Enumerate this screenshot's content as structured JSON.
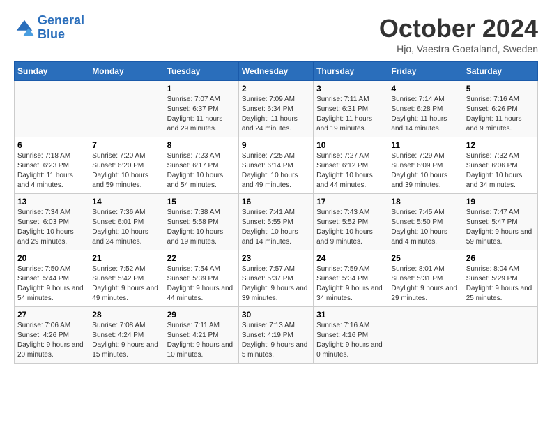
{
  "logo": {
    "line1": "General",
    "line2": "Blue"
  },
  "title": "October 2024",
  "location": "Hjo, Vaestra Goetaland, Sweden",
  "days_of_week": [
    "Sunday",
    "Monday",
    "Tuesday",
    "Wednesday",
    "Thursday",
    "Friday",
    "Saturday"
  ],
  "weeks": [
    [
      {
        "day": "",
        "info": ""
      },
      {
        "day": "",
        "info": ""
      },
      {
        "day": "1",
        "info": "Sunrise: 7:07 AM\nSunset: 6:37 PM\nDaylight: 11 hours and 29 minutes."
      },
      {
        "day": "2",
        "info": "Sunrise: 7:09 AM\nSunset: 6:34 PM\nDaylight: 11 hours and 24 minutes."
      },
      {
        "day": "3",
        "info": "Sunrise: 7:11 AM\nSunset: 6:31 PM\nDaylight: 11 hours and 19 minutes."
      },
      {
        "day": "4",
        "info": "Sunrise: 7:14 AM\nSunset: 6:28 PM\nDaylight: 11 hours and 14 minutes."
      },
      {
        "day": "5",
        "info": "Sunrise: 7:16 AM\nSunset: 6:26 PM\nDaylight: 11 hours and 9 minutes."
      }
    ],
    [
      {
        "day": "6",
        "info": "Sunrise: 7:18 AM\nSunset: 6:23 PM\nDaylight: 11 hours and 4 minutes."
      },
      {
        "day": "7",
        "info": "Sunrise: 7:20 AM\nSunset: 6:20 PM\nDaylight: 10 hours and 59 minutes."
      },
      {
        "day": "8",
        "info": "Sunrise: 7:23 AM\nSunset: 6:17 PM\nDaylight: 10 hours and 54 minutes."
      },
      {
        "day": "9",
        "info": "Sunrise: 7:25 AM\nSunset: 6:14 PM\nDaylight: 10 hours and 49 minutes."
      },
      {
        "day": "10",
        "info": "Sunrise: 7:27 AM\nSunset: 6:12 PM\nDaylight: 10 hours and 44 minutes."
      },
      {
        "day": "11",
        "info": "Sunrise: 7:29 AM\nSunset: 6:09 PM\nDaylight: 10 hours and 39 minutes."
      },
      {
        "day": "12",
        "info": "Sunrise: 7:32 AM\nSunset: 6:06 PM\nDaylight: 10 hours and 34 minutes."
      }
    ],
    [
      {
        "day": "13",
        "info": "Sunrise: 7:34 AM\nSunset: 6:03 PM\nDaylight: 10 hours and 29 minutes."
      },
      {
        "day": "14",
        "info": "Sunrise: 7:36 AM\nSunset: 6:01 PM\nDaylight: 10 hours and 24 minutes."
      },
      {
        "day": "15",
        "info": "Sunrise: 7:38 AM\nSunset: 5:58 PM\nDaylight: 10 hours and 19 minutes."
      },
      {
        "day": "16",
        "info": "Sunrise: 7:41 AM\nSunset: 5:55 PM\nDaylight: 10 hours and 14 minutes."
      },
      {
        "day": "17",
        "info": "Sunrise: 7:43 AM\nSunset: 5:52 PM\nDaylight: 10 hours and 9 minutes."
      },
      {
        "day": "18",
        "info": "Sunrise: 7:45 AM\nSunset: 5:50 PM\nDaylight: 10 hours and 4 minutes."
      },
      {
        "day": "19",
        "info": "Sunrise: 7:47 AM\nSunset: 5:47 PM\nDaylight: 9 hours and 59 minutes."
      }
    ],
    [
      {
        "day": "20",
        "info": "Sunrise: 7:50 AM\nSunset: 5:44 PM\nDaylight: 9 hours and 54 minutes."
      },
      {
        "day": "21",
        "info": "Sunrise: 7:52 AM\nSunset: 5:42 PM\nDaylight: 9 hours and 49 minutes."
      },
      {
        "day": "22",
        "info": "Sunrise: 7:54 AM\nSunset: 5:39 PM\nDaylight: 9 hours and 44 minutes."
      },
      {
        "day": "23",
        "info": "Sunrise: 7:57 AM\nSunset: 5:37 PM\nDaylight: 9 hours and 39 minutes."
      },
      {
        "day": "24",
        "info": "Sunrise: 7:59 AM\nSunset: 5:34 PM\nDaylight: 9 hours and 34 minutes."
      },
      {
        "day": "25",
        "info": "Sunrise: 8:01 AM\nSunset: 5:31 PM\nDaylight: 9 hours and 29 minutes."
      },
      {
        "day": "26",
        "info": "Sunrise: 8:04 AM\nSunset: 5:29 PM\nDaylight: 9 hours and 25 minutes."
      }
    ],
    [
      {
        "day": "27",
        "info": "Sunrise: 7:06 AM\nSunset: 4:26 PM\nDaylight: 9 hours and 20 minutes."
      },
      {
        "day": "28",
        "info": "Sunrise: 7:08 AM\nSunset: 4:24 PM\nDaylight: 9 hours and 15 minutes."
      },
      {
        "day": "29",
        "info": "Sunrise: 7:11 AM\nSunset: 4:21 PM\nDaylight: 9 hours and 10 minutes."
      },
      {
        "day": "30",
        "info": "Sunrise: 7:13 AM\nSunset: 4:19 PM\nDaylight: 9 hours and 5 minutes."
      },
      {
        "day": "31",
        "info": "Sunrise: 7:16 AM\nSunset: 4:16 PM\nDaylight: 9 hours and 0 minutes."
      },
      {
        "day": "",
        "info": ""
      },
      {
        "day": "",
        "info": ""
      }
    ]
  ]
}
